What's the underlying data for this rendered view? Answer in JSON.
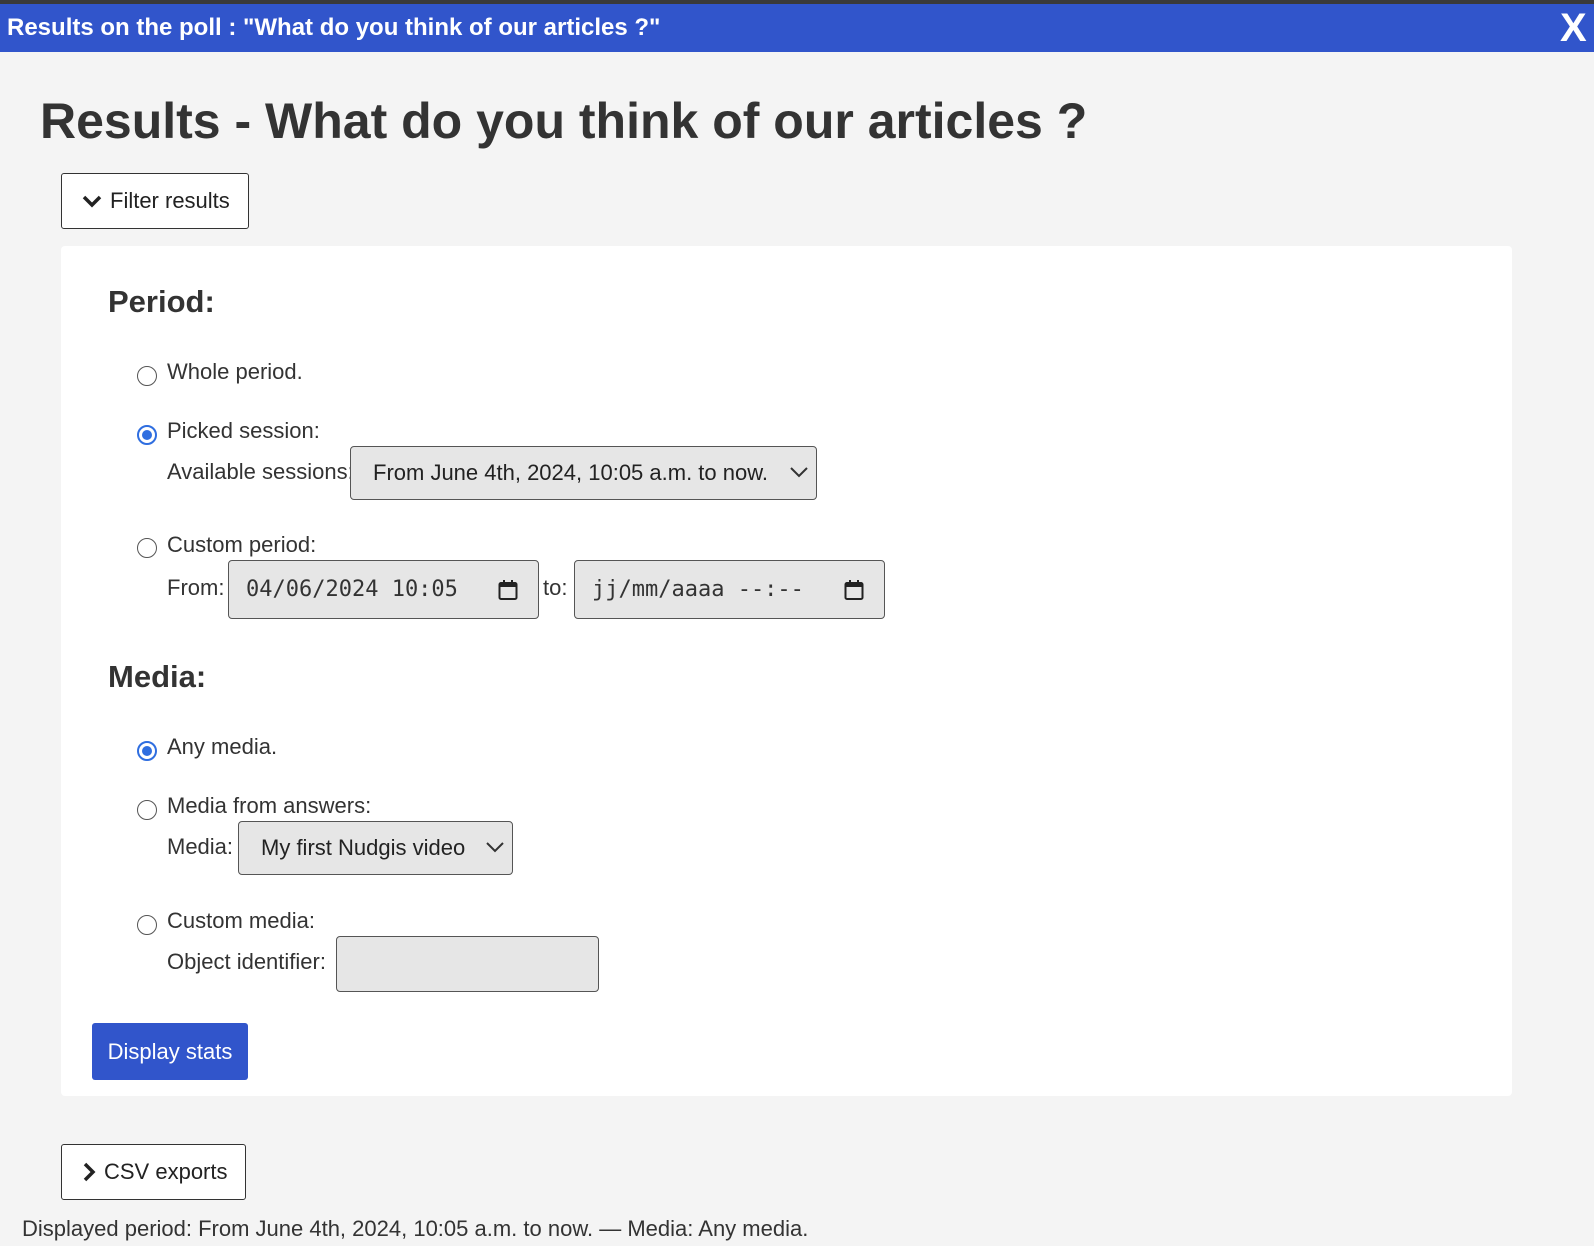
{
  "modal": {
    "title": "Results on the poll : \"What do you think of our articles ?\"",
    "close_label": "X"
  },
  "page": {
    "heading": "Results - What do you think of our articles ?"
  },
  "filter": {
    "toggle_label": "Filter results",
    "period": {
      "heading": "Period:",
      "whole_label": "Whole period.",
      "picked_label": "Picked session:",
      "sessions_label": "Available sessions:",
      "sessions_selected": "From June 4th, 2024, 10:05 a.m. to now.",
      "custom_label": "Custom period:",
      "from_label": "From:",
      "from_value": "04/06/2024 10:05",
      "to_label": "to:",
      "to_placeholder": "jj/mm/aaaa --:--",
      "selected": "picked"
    },
    "media": {
      "heading": "Media:",
      "any_label": "Any media.",
      "answers_label": "Media from answers:",
      "media_label": "Media:",
      "media_selected": "My first Nudgis video",
      "custom_label": "Custom media:",
      "object_label": "Object identifier:",
      "object_value": "",
      "selected": "any"
    },
    "submit_label": "Display stats"
  },
  "csv": {
    "toggle_label": "CSV exports"
  },
  "footer": {
    "summary": "Displayed period: From June 4th, 2024, 10:05 a.m. to now. — Media: Any media."
  },
  "colors": {
    "accent": "#3155cb",
    "radio_checked": "#2f6ee0"
  }
}
